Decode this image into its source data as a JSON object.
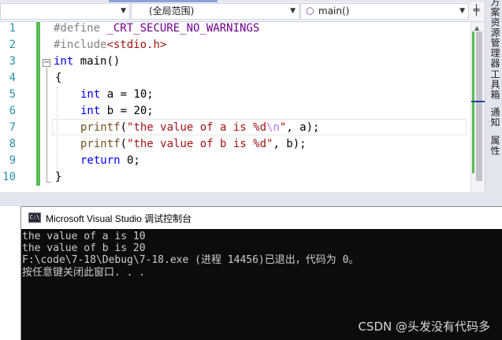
{
  "navbar": {
    "project_dropdown": "",
    "scope_dropdown": "(全局范围)",
    "member_dropdown": "main()",
    "split_icon": "split-icon"
  },
  "editor": {
    "line_numbers": [
      "1",
      "2",
      "3",
      "4",
      "5",
      "6",
      "7",
      "8",
      "9",
      "10"
    ],
    "lines": {
      "l1_directive": "#define ",
      "l1_macro": "_CRT_SECURE_NO_WARNINGS",
      "l2_directive": "#include",
      "l2_header": "<stdio.h>",
      "l3_type": "int",
      "l3_rest": " main()",
      "l4": "{",
      "l5_type": "int",
      "l5_rest": " a = 10;",
      "l6_type": "int",
      "l6_rest": " b = 20;",
      "l7_fn": "printf",
      "l7_open": "(",
      "l7_str1": "\"the value of a is %d",
      "l7_esc": "\\n",
      "l7_str2": "\"",
      "l7_rest": ", a);",
      "l8_fn": "printf",
      "l8_open": "(",
      "l8_str": "\"the value of b is %d\"",
      "l8_rest": ", b);",
      "l9_kw": "return",
      "l9_rest": " 0;",
      "l10": "}"
    }
  },
  "right_panel": {
    "tabs": [
      "解决方案资源管理器",
      "工具箱",
      "通知",
      "属性"
    ]
  },
  "console": {
    "title": "Microsoft Visual Studio 调试控制台",
    "icon_label": "C:\\",
    "output": [
      "the value of a is 10",
      "the value of b is 20",
      "F:\\code\\7-18\\Debug\\7-18.exe (进程 14456)已退出，代码为 0。",
      "按任意键关闭此窗口. . ."
    ]
  },
  "watermark": "CSDN @头发没有代码多",
  "colors": {
    "keyword": "#0000ff",
    "string": "#a31515",
    "macro": "#6f008a",
    "line_number": "#2b91af",
    "change_bar": "#57bb57",
    "console_bg": "#0c0c0c"
  }
}
